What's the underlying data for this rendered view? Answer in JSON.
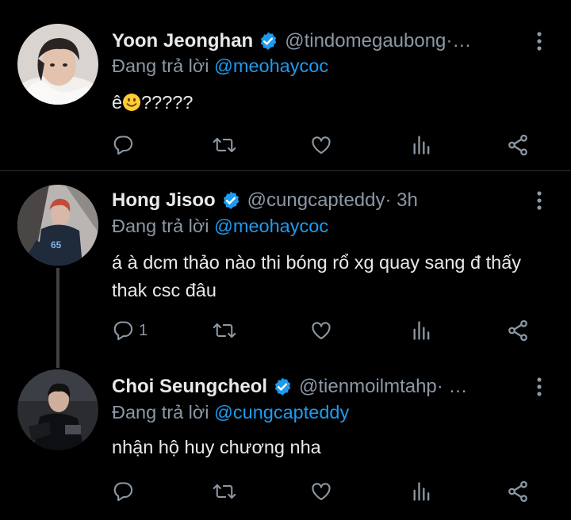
{
  "tweets": [
    {
      "name": "Yoon Jeonghan",
      "handle": "@tindomegaubong",
      "handle_suffix": " ·…",
      "time": "",
      "reply_prefix": "Đang trả lời ",
      "reply_to": "@meohaycoc",
      "text_before": "ê",
      "emoji": "smiling-face",
      "text_after": "?????",
      "reply_count": "",
      "verified": true
    },
    {
      "name": "Hong Jisoo",
      "handle": "@cungcapteddy",
      "handle_suffix": "",
      "time": " · 3h",
      "reply_prefix": "Đang trả lời ",
      "reply_to": "@meohaycoc",
      "text": "á à dcm thảo nào thi bóng rổ xg quay sang đ thấy thak csc đâu",
      "reply_count": "1",
      "verified": true
    },
    {
      "name": "Choi Seungcheol",
      "handle": "@tienmoilmtahp",
      "handle_suffix": " · …",
      "time": "",
      "reply_prefix": "Đang trả lời ",
      "reply_to": "@cungcapteddy",
      "text": "nhận hộ huy chương nha",
      "reply_count": "",
      "verified": true
    }
  ],
  "icons": {
    "reply": "speech-bubble-icon",
    "retweet": "retweet-icon",
    "like": "heart-icon",
    "views": "bar-chart-icon",
    "share": "share-icon",
    "more": "vertical-dots-icon",
    "verified": "verified-badge-icon"
  },
  "colors": {
    "background": "#000000",
    "text": "#e7e9ea",
    "secondary": "#8b98a5",
    "accent": "#1d9bf0",
    "divider": "#2f3336"
  }
}
